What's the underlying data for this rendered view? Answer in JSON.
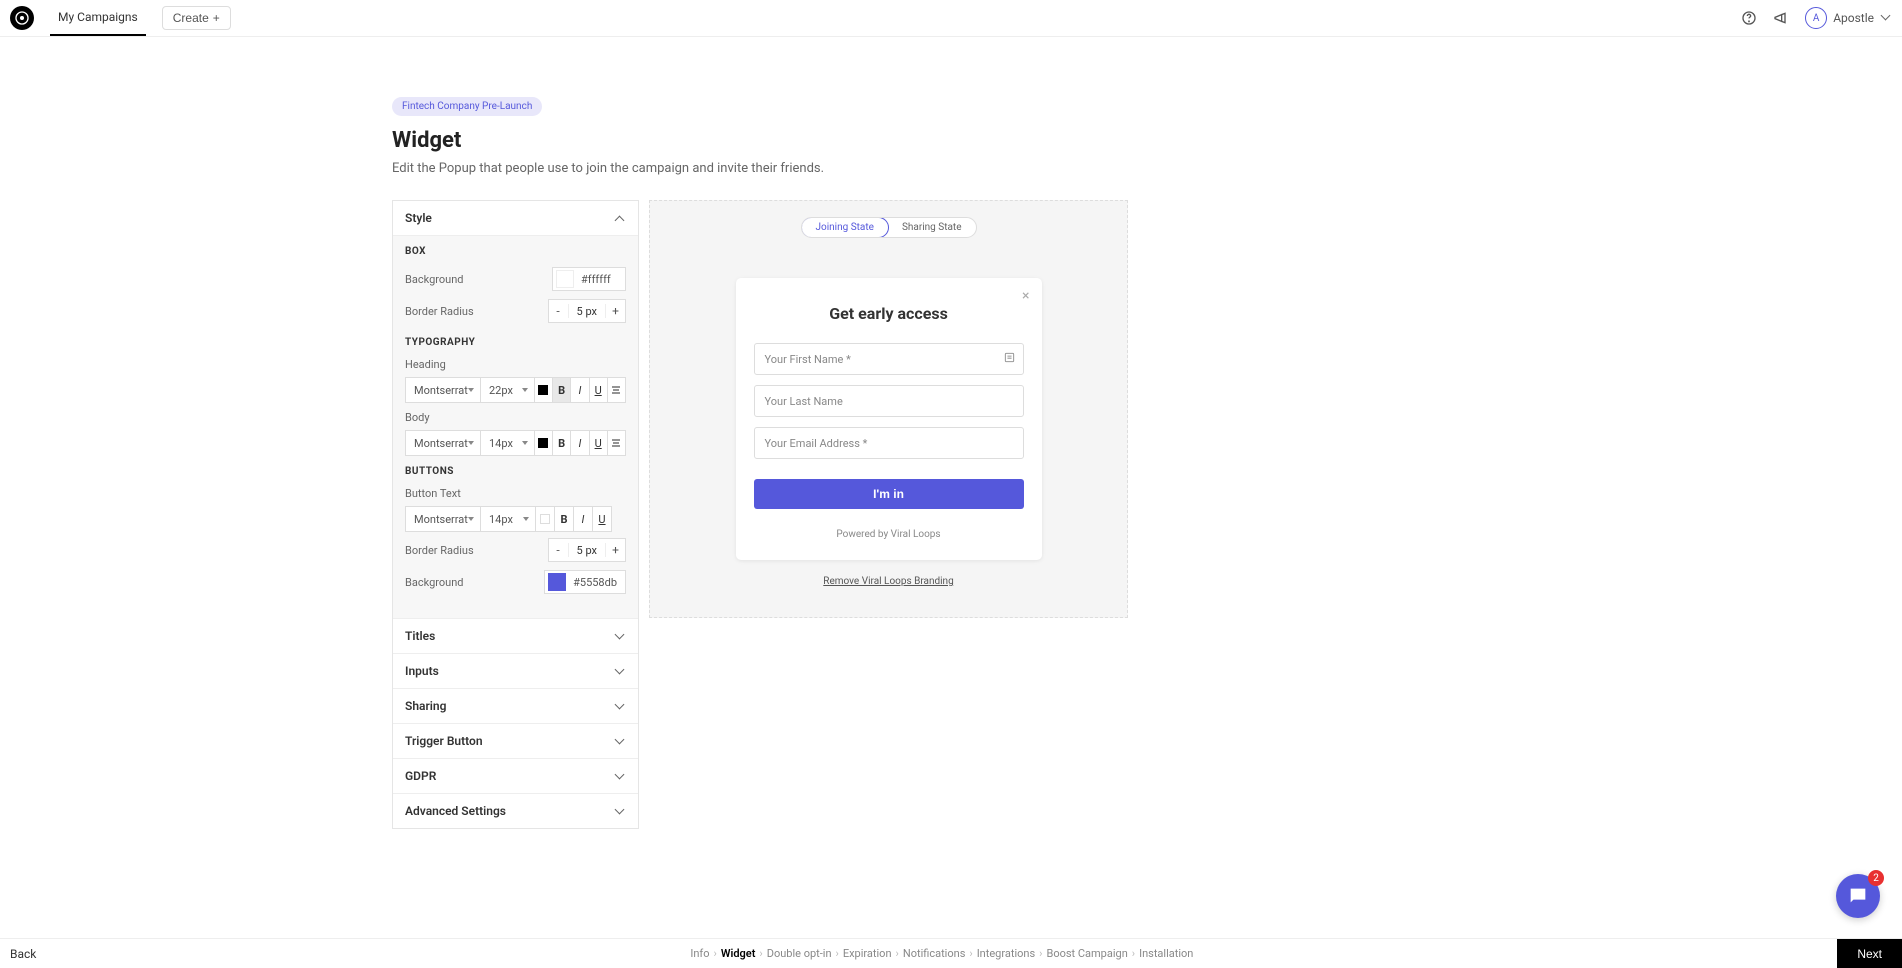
{
  "nav": {
    "tab": "My Campaigns",
    "create": "Create",
    "user": "Apostle",
    "avatar_letter": "A"
  },
  "page": {
    "chip": "Fintech Company Pre-Launch",
    "title": "Widget",
    "subtitle": "Edit the Popup that people use to join the campaign and invite their friends."
  },
  "accordion": {
    "style": "Style",
    "titles": "Titles",
    "inputs": "Inputs",
    "sharing": "Sharing",
    "trigger": "Trigger Button",
    "gdpr": "GDPR",
    "advanced": "Advanced Settings"
  },
  "style_panel": {
    "box_heading": "BOX",
    "background_label": "Background",
    "background_value": "#ffffff",
    "radius_label": "Border Radius",
    "radius_value": "5 px",
    "typo_heading": "TYPOGRAPHY",
    "heading_label": "Heading",
    "heading_font": "Montserrat",
    "heading_size": "22px",
    "body_label": "Body",
    "body_font": "Montserrat",
    "body_size": "14px",
    "buttons_heading": "BUTTONS",
    "btn_text_label": "Button Text",
    "btn_font": "Montserrat",
    "btn_size": "14px",
    "btn_radius_label": "Border Radius",
    "btn_radius_value": "5 px",
    "btn_bg_label": "Background",
    "btn_bg_value": "#5558db",
    "fmt_b": "B",
    "fmt_i": "I",
    "fmt_u": "U"
  },
  "preview": {
    "joining_state": "Joining State",
    "sharing_state": "Sharing State",
    "popup_title": "Get early access",
    "first_name": "Your First Name *",
    "last_name": "Your Last Name",
    "email": "Your Email Address *",
    "cta": "I'm in",
    "powered": "Powered by Viral Loops",
    "remove_branding": "Remove Viral Loops Branding"
  },
  "bottom": {
    "back": "Back",
    "next": "Next",
    "crumbs": [
      "Info",
      "Widget",
      "Double opt-in",
      "Expiration",
      "Notifications",
      "Integrations",
      "Boost Campaign",
      "Installation"
    ]
  },
  "chat": {
    "badge": "2"
  }
}
